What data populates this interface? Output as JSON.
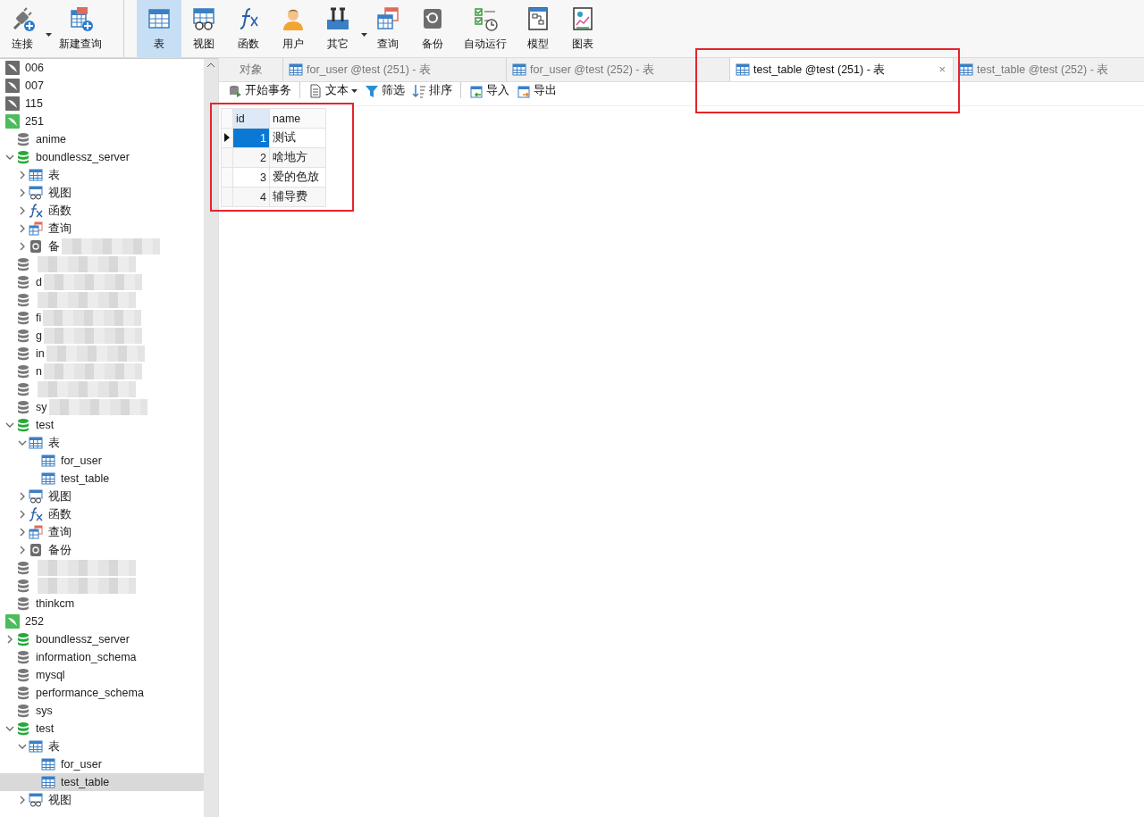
{
  "toolbar": [
    {
      "items": [
        {
          "label": "连接",
          "kind": "connect",
          "dropdown": true,
          "selected": false
        },
        {
          "label": "新建查询",
          "kind": "new-query",
          "dropdown": false,
          "selected": false
        }
      ]
    },
    {
      "items": [
        {
          "label": "表",
          "kind": "table",
          "dropdown": false,
          "selected": true
        },
        {
          "label": "视图",
          "kind": "view",
          "dropdown": false,
          "selected": false
        },
        {
          "label": "函数",
          "kind": "function",
          "dropdown": false,
          "selected": false
        },
        {
          "label": "用户",
          "kind": "user",
          "dropdown": false,
          "selected": false
        },
        {
          "label": "其它",
          "kind": "tools",
          "dropdown": true,
          "selected": false
        },
        {
          "label": "查询",
          "kind": "query",
          "dropdown": false,
          "selected": false
        },
        {
          "label": "备份",
          "kind": "backup",
          "dropdown": false,
          "selected": false
        },
        {
          "label": "自动运行",
          "kind": "schedule",
          "dropdown": false,
          "selected": false
        },
        {
          "label": "模型",
          "kind": "model",
          "dropdown": false,
          "selected": false
        },
        {
          "label": "图表",
          "kind": "chart",
          "dropdown": false,
          "selected": false
        }
      ]
    }
  ],
  "sidebar": {
    "items": [
      {
        "label": "006",
        "kind": "connection",
        "open": false
      },
      {
        "label": "007",
        "kind": "connection",
        "open": false
      },
      {
        "label": "115",
        "kind": "connection",
        "open": false
      },
      {
        "label": "251",
        "kind": "connection",
        "open": true,
        "children": [
          {
            "label": "anime",
            "kind": "database",
            "open": false
          },
          {
            "label": "boundlessz_server",
            "kind": "database",
            "open": true,
            "expanded": true,
            "children": [
              {
                "label": "表",
                "kind": "tables",
                "expanded": false
              },
              {
                "label": "视图",
                "kind": "views",
                "expanded": false
              },
              {
                "label": "函数",
                "kind": "functions",
                "expanded": false
              },
              {
                "label": "查询",
                "kind": "queries",
                "expanded": false
              },
              {
                "label": "备",
                "kind": "backups",
                "expanded": false,
                "redacted": true
              }
            ]
          },
          {
            "kind": "database",
            "open": false,
            "redacted": true
          },
          {
            "label": "d",
            "kind": "database",
            "open": false,
            "redacted": true
          },
          {
            "kind": "database",
            "open": false,
            "redacted": true
          },
          {
            "label": "fi",
            "kind": "database",
            "open": false,
            "redacted": true
          },
          {
            "label": "g",
            "kind": "database",
            "open": false,
            "redacted": true
          },
          {
            "label": "in",
            "kind": "database",
            "open": false,
            "redacted": true
          },
          {
            "label": "n",
            "kind": "database",
            "open": false,
            "redacted": true
          },
          {
            "kind": "database",
            "open": false,
            "redacted": true
          },
          {
            "label": "sy",
            "kind": "database",
            "open": false,
            "redacted": true
          },
          {
            "label": "test",
            "kind": "database",
            "open": true,
            "expanded": true,
            "children": [
              {
                "label": "表",
                "kind": "tables",
                "expanded": true,
                "children": [
                  {
                    "label": "for_user",
                    "kind": "table",
                    "selected": false
                  },
                  {
                    "label": "test_table",
                    "kind": "table",
                    "selected": false
                  }
                ]
              },
              {
                "label": "视图",
                "kind": "views",
                "expanded": false
              },
              {
                "label": "函数",
                "kind": "functions",
                "expanded": false
              },
              {
                "label": "查询",
                "kind": "queries",
                "expanded": false
              },
              {
                "label": "备份",
                "kind": "backups",
                "expanded": false
              }
            ]
          },
          {
            "kind": "database",
            "open": false,
            "redacted": true
          },
          {
            "kind": "database",
            "open": false,
            "redacted": true
          },
          {
            "label": "thinkcm",
            "kind": "database",
            "open": false
          }
        ]
      },
      {
        "label": "252",
        "kind": "connection",
        "open": true,
        "children": [
          {
            "label": "boundlessz_server",
            "kind": "database",
            "open": true,
            "expanded": false
          },
          {
            "label": "information_schema",
            "kind": "database",
            "open": false
          },
          {
            "label": "mysql",
            "kind": "database",
            "open": false
          },
          {
            "label": "performance_schema",
            "kind": "database",
            "open": false
          },
          {
            "label": "sys",
            "kind": "database",
            "open": false
          },
          {
            "label": "test",
            "kind": "database",
            "open": true,
            "expanded": true,
            "children": [
              {
                "label": "表",
                "kind": "tables",
                "expanded": true,
                "children": [
                  {
                    "label": "for_user",
                    "kind": "table",
                    "selected": false
                  },
                  {
                    "label": "test_table",
                    "kind": "table",
                    "selected": true
                  }
                ]
              },
              {
                "label": "视图",
                "kind": "views",
                "expanded": false
              }
            ]
          }
        ]
      }
    ]
  },
  "tabs": [
    {
      "label": "对象",
      "kind": "objects",
      "selected": false
    },
    {
      "label": "for_user @test (251) - 表",
      "kind": "table",
      "selected": false
    },
    {
      "label": "for_user @test (252) - 表",
      "kind": "table",
      "selected": false
    },
    {
      "label": "test_table @test (251) - 表",
      "kind": "table",
      "selected": true,
      "close": "×",
      "highlighted": true
    },
    {
      "label": "test_table @test (252) - 表",
      "kind": "table",
      "selected": false
    }
  ],
  "subtoolbar": [
    {
      "items": [
        {
          "label": "开始事务",
          "kind": "transaction",
          "dropdown": false
        }
      ]
    },
    {
      "items": [
        {
          "label": "文本",
          "kind": "text",
          "dropdown": true
        },
        {
          "label": "筛选",
          "kind": "filter",
          "dropdown": false
        },
        {
          "label": "排序",
          "kind": "sort",
          "dropdown": false
        }
      ]
    },
    {
      "items": [
        {
          "label": "导入",
          "kind": "import",
          "dropdown": false
        },
        {
          "label": "导出",
          "kind": "export",
          "dropdown": false
        }
      ]
    }
  ],
  "grid": {
    "highlighted": true,
    "columns": [
      {
        "label": "id"
      },
      {
        "label": "name"
      }
    ],
    "rows": [
      {
        "cells": [
          "1",
          "测试"
        ],
        "selected": true
      },
      {
        "cells": [
          "2",
          "啥地方"
        ],
        "selected": false
      },
      {
        "cells": [
          "3",
          "爱的色放"
        ],
        "selected": false
      },
      {
        "cells": [
          "4",
          "辅导费"
        ],
        "selected": false
      }
    ]
  }
}
